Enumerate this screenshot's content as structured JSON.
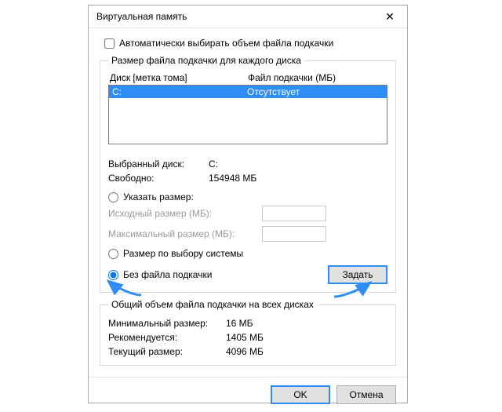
{
  "window": {
    "title": "Виртуальная память",
    "close_icon": "✕"
  },
  "auto_checkbox": {
    "label": "Автоматически выбирать объем файла подкачки"
  },
  "drives_group": {
    "legend": "Размер файла подкачки для каждого диска",
    "col_drive": "Диск [метка тома]",
    "col_file": "Файл подкачки (МБ)",
    "rows": [
      {
        "drive": "C:",
        "file": "Отсутствует"
      }
    ],
    "selected_drive_label": "Выбранный диск:",
    "selected_drive_value": "C:",
    "free_label": "Свободно:",
    "free_value": "154948 МБ",
    "radio_custom": "Указать размер:",
    "initial_label": "Исходный размер (МБ):",
    "max_label": "Максимальный размер (МБ):",
    "radio_system": "Размер по выбору системы",
    "radio_none": "Без файла подкачки",
    "set_button": "Задать"
  },
  "totals_group": {
    "legend": "Общий объем файла подкачки на всех дисках",
    "min_label": "Минимальный размер:",
    "min_value": "16 МБ",
    "rec_label": "Рекомендуется:",
    "rec_value": "1405 МБ",
    "cur_label": "Текущий размер:",
    "cur_value": "4096 МБ"
  },
  "buttons": {
    "ok": "OK",
    "cancel": "Отмена"
  }
}
